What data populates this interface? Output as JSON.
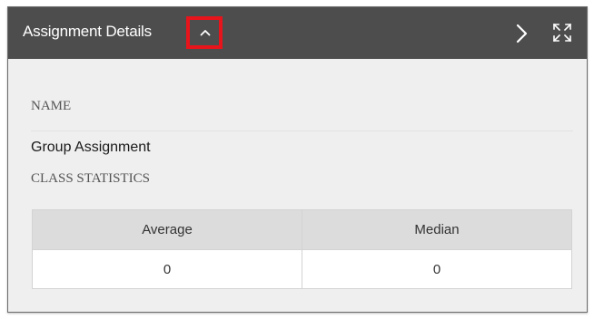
{
  "header": {
    "title": "Assignment Details",
    "collapse_icon": "chevron-up-icon",
    "next_icon": "chevron-right-icon",
    "expand_icon": "expand-icon",
    "highlight_color": "#e8141b",
    "background_color": "#4d4d4d"
  },
  "details": {
    "name_label": "NAME",
    "name_value": "Group Assignment",
    "stats_label": "CLASS STATISTICS"
  },
  "stats_table": {
    "columns": [
      "Average",
      "Median"
    ],
    "rows": [
      [
        "0",
        "0"
      ]
    ]
  }
}
